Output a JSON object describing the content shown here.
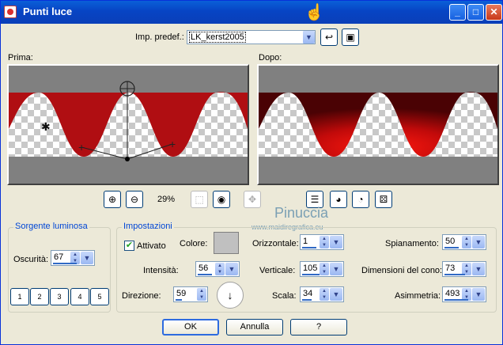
{
  "window": {
    "title": "Punti luce"
  },
  "titlebar_buttons": {
    "minimize": "_",
    "maximize": "□",
    "close": "✕"
  },
  "preset": {
    "label": "Imp. predef.:",
    "value": "LK_kerst2005"
  },
  "previews": {
    "before_label": "Prima:",
    "after_label": "Dopo:"
  },
  "zoom": {
    "level": "29%"
  },
  "watermark": {
    "name": "Pinuccia",
    "url": "www.maidiregrafica.eu"
  },
  "light_source": {
    "group_title": "Sorgente luminosa",
    "darkness_label": "Oscurità:",
    "darkness_value": "67",
    "light_buttons": [
      "1",
      "2",
      "3",
      "4",
      "5"
    ]
  },
  "settings": {
    "group_title": "Impostazioni",
    "enabled_label": "Attivato",
    "enabled": true,
    "color_label": "Colore:",
    "color": "#c0c0c0",
    "intensity_label": "Intensità:",
    "intensity_value": "56",
    "direction_label": "Direzione:",
    "direction_value": "59",
    "horizontal_label": "Orizzontale:",
    "horizontal_value": "1",
    "vertical_label": "Verticale:",
    "vertical_value": "105",
    "scale_label": "Scala:",
    "scale_value": "34",
    "smoothing_label": "Spianamento:",
    "smoothing_value": "50",
    "cone_label": "Dimensioni del cono:",
    "cone_value": "73",
    "asymmetry_label": "Asimmetria:",
    "asymmetry_value": "493"
  },
  "buttons": {
    "ok": "OK",
    "cancel": "Annulla",
    "help": "?"
  }
}
